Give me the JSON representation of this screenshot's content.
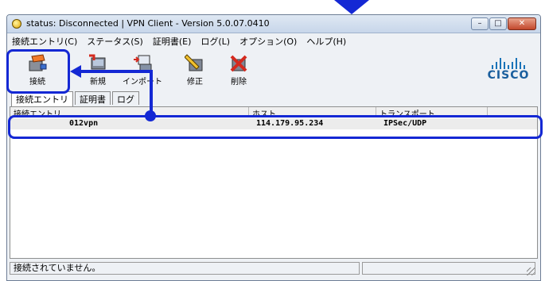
{
  "window": {
    "title": "status: Disconnected | VPN Client - Version 5.0.07.0410",
    "controls": {
      "minimize": "–",
      "maximize": "□",
      "close": "✕"
    }
  },
  "menu": [
    "接続エントリ(C)",
    "ステータス(S)",
    "証明書(E)",
    "ログ(L)",
    "オプション(O)",
    "ヘルプ(H)"
  ],
  "toolbar": {
    "connect": "接続",
    "new": "新規",
    "import": "インポート",
    "modify": "修正",
    "delete": "削除"
  },
  "brand": {
    "logo_text": "CISCO",
    "color": "#1a5f9e"
  },
  "tabs": [
    "接続エントリ",
    "証明書",
    "ログ"
  ],
  "table": {
    "columns": [
      "接続エントリ",
      "ホスト",
      "トランスポート"
    ],
    "rows": [
      {
        "entry": "012vpn",
        "host": "114.179.95.234",
        "transport": "IPSec/UDP"
      }
    ]
  },
  "status": {
    "text": "接続されていません。"
  },
  "colors": {
    "annotation": "#1428d4",
    "cisco_blue": "#1a73b8"
  }
}
